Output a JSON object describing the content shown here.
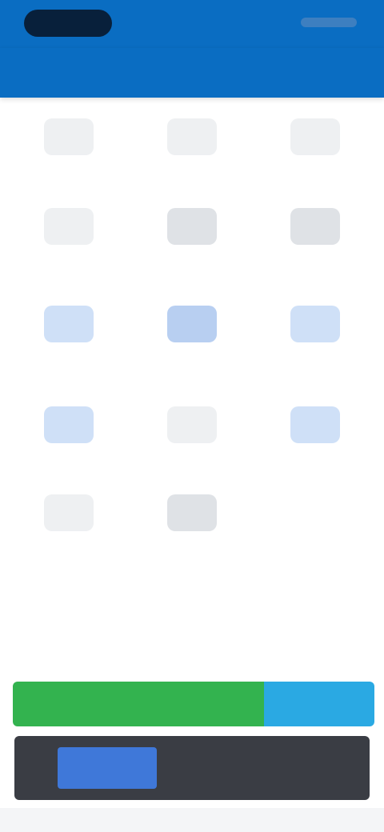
{
  "header": {
    "title": ""
  },
  "grid": {
    "tiles": [
      {
        "label": "",
        "icon": "document-icon",
        "style": "grey"
      },
      {
        "label": "",
        "icon": "document-icon",
        "style": "grey"
      },
      {
        "label": "",
        "icon": "document-icon",
        "style": "grey"
      },
      {
        "label": "",
        "icon": "chart-icon",
        "style": "grey"
      },
      {
        "label": "",
        "icon": "briefcase-icon",
        "style": "grey dark"
      },
      {
        "label": "",
        "icon": "calendar-icon",
        "style": "grey dark"
      },
      {
        "label": "",
        "icon": "mail-icon",
        "style": "blue"
      },
      {
        "label": "",
        "icon": "folder-icon",
        "style": "blue strong"
      },
      {
        "label": "",
        "icon": "tag-icon",
        "style": "blue"
      },
      {
        "label": "",
        "icon": "file-icon",
        "style": "blue"
      },
      {
        "label": "",
        "icon": "user-icon",
        "style": "grey"
      },
      {
        "label": "",
        "icon": "location-icon",
        "style": "blue"
      },
      {
        "label": "",
        "icon": "settings-icon",
        "style": "grey"
      },
      {
        "label": "",
        "icon": "phone-icon",
        "style": "grey dark"
      }
    ]
  },
  "footer": {
    "left_line_1": "",
    "left_line_2": "",
    "right_note": ""
  },
  "actions": {
    "primary_label": "",
    "secondary_label": ""
  },
  "promo": {
    "button_label": "",
    "text": ""
  },
  "colors": {
    "header": "#0a6dc2",
    "primary_button": "#33b34f",
    "secondary_button": "#2aa9e3",
    "promo_button": "#3f78d9",
    "promo_background": "#3a3d44"
  }
}
